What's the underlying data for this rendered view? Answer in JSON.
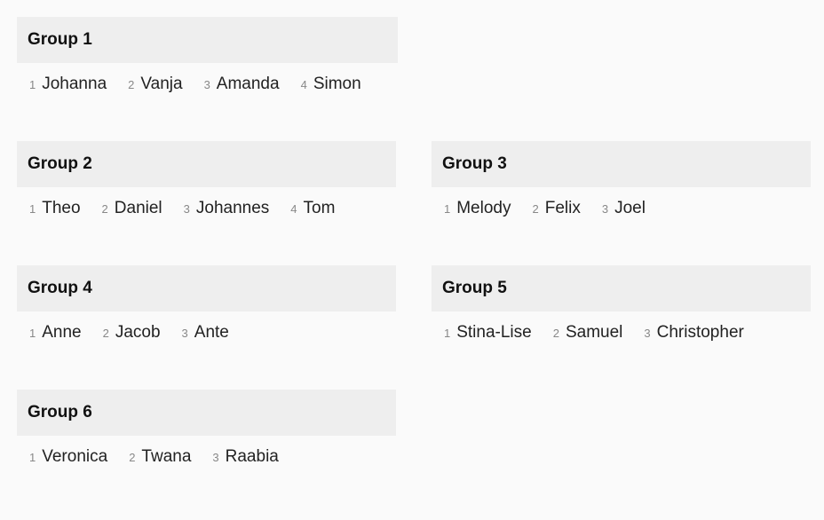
{
  "groups": [
    {
      "title": "Group 1",
      "members": [
        {
          "num": "1",
          "name": "Johanna"
        },
        {
          "num": "2",
          "name": "Vanja"
        },
        {
          "num": "3",
          "name": "Amanda"
        },
        {
          "num": "4",
          "name": "Simon"
        }
      ]
    },
    {
      "title": "Group 2",
      "members": [
        {
          "num": "1",
          "name": "Theo"
        },
        {
          "num": "2",
          "name": "Daniel"
        },
        {
          "num": "3",
          "name": "Johannes"
        },
        {
          "num": "4",
          "name": "Tom"
        }
      ]
    },
    {
      "title": "Group 3",
      "members": [
        {
          "num": "1",
          "name": "Melody"
        },
        {
          "num": "2",
          "name": "Felix"
        },
        {
          "num": "3",
          "name": "Joel"
        }
      ]
    },
    {
      "title": "Group 4",
      "members": [
        {
          "num": "1",
          "name": "Anne"
        },
        {
          "num": "2",
          "name": "Jacob"
        },
        {
          "num": "3",
          "name": "Ante"
        }
      ]
    },
    {
      "title": "Group 5",
      "members": [
        {
          "num": "1",
          "name": "Stina-Lise"
        },
        {
          "num": "2",
          "name": "Samuel"
        },
        {
          "num": "3",
          "name": "Christopher"
        }
      ]
    },
    {
      "title": "Group 6",
      "members": [
        {
          "num": "1",
          "name": "Veronica"
        },
        {
          "num": "2",
          "name": "Twana"
        },
        {
          "num": "3",
          "name": "Raabia"
        }
      ]
    }
  ]
}
